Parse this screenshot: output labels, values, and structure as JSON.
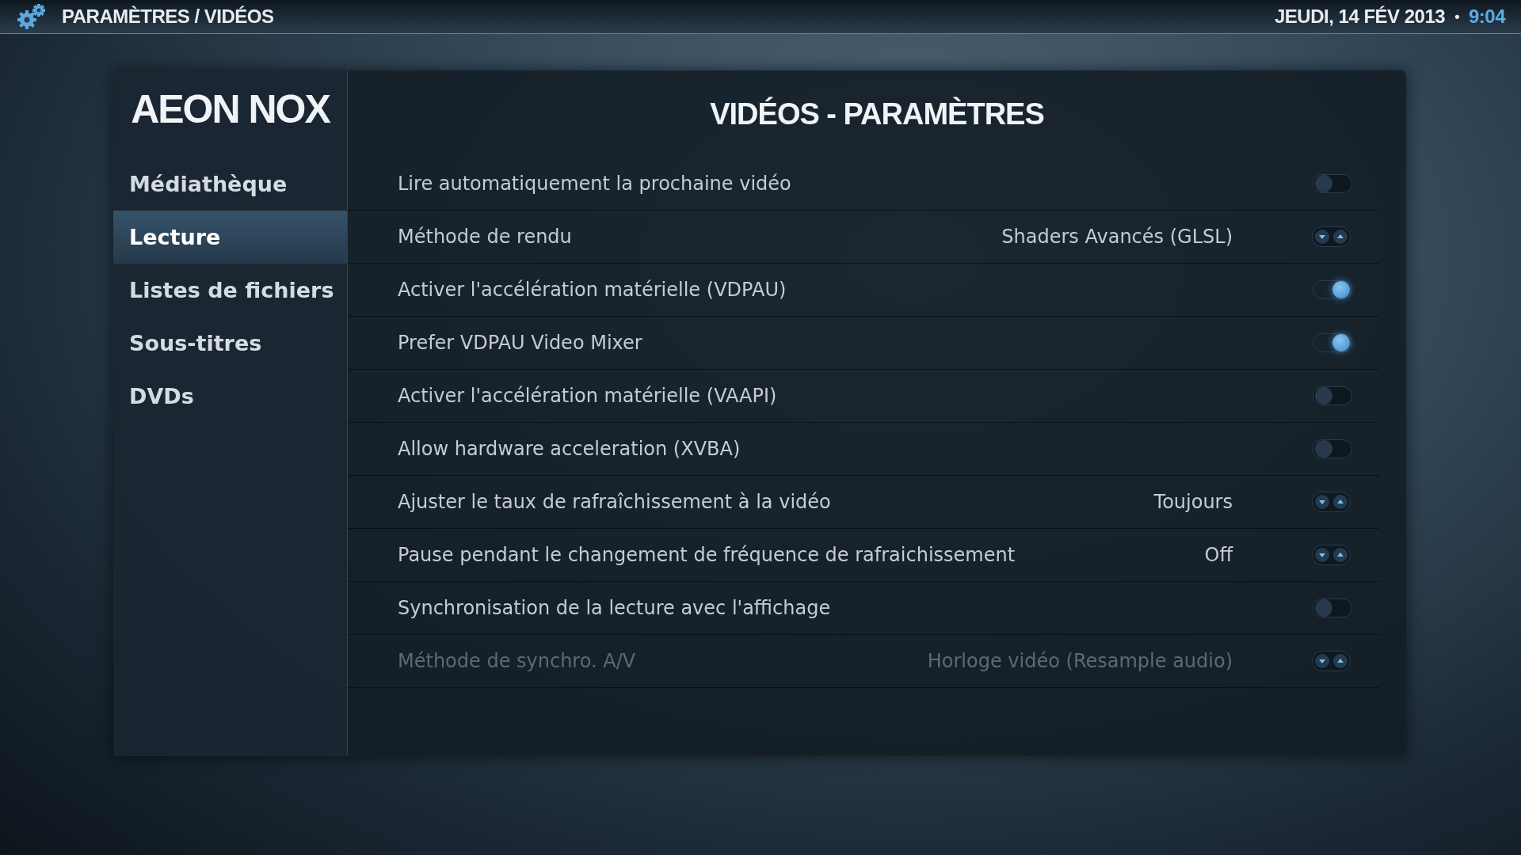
{
  "top_bar": {
    "breadcrumb": "PARAMÈTRES / VIDÉOS",
    "date": "JEUDI, 14 FÉV 2013",
    "separator": "•",
    "time": "9:04"
  },
  "sidebar": {
    "logo": "AEON NOX",
    "items": [
      {
        "label": "Médiathèque",
        "selected": false
      },
      {
        "label": "Lecture",
        "selected": true
      },
      {
        "label": "Listes de fichiers",
        "selected": false
      },
      {
        "label": "Sous-titres",
        "selected": false
      },
      {
        "label": "DVDs",
        "selected": false
      }
    ]
  },
  "content": {
    "title": "VIDÉOS - PARAMÈTRES",
    "settings": [
      {
        "kind": "toggle",
        "label": "Lire automatiquement la prochaine vidéo",
        "on": false,
        "disabled": false
      },
      {
        "kind": "spinner",
        "label": "Méthode de rendu",
        "value": "Shaders Avancés (GLSL)",
        "disabled": false
      },
      {
        "kind": "toggle",
        "label": "Activer l'accélération matérielle (VDPAU)",
        "on": true,
        "disabled": false
      },
      {
        "kind": "toggle",
        "label": "Prefer VDPAU Video Mixer",
        "on": true,
        "disabled": false
      },
      {
        "kind": "toggle",
        "label": "Activer l'accélération matérielle (VAAPI)",
        "on": false,
        "disabled": false
      },
      {
        "kind": "toggle",
        "label": "Allow hardware acceleration (XVBA)",
        "on": false,
        "disabled": false
      },
      {
        "kind": "spinner",
        "label": "Ajuster le taux de rafraîchissement à la vidéo",
        "value": "Toujours",
        "disabled": false
      },
      {
        "kind": "spinner",
        "label": "Pause pendant le changement de fréquence de rafraichissement",
        "value": "Off",
        "disabled": false
      },
      {
        "kind": "toggle",
        "label": "Synchronisation de la lecture avec l'affichage",
        "on": false,
        "disabled": false
      },
      {
        "kind": "spinner",
        "label": "Méthode de synchro. A/V",
        "value": "Horloge vidéo (Resample audio)",
        "disabled": true
      }
    ]
  }
}
